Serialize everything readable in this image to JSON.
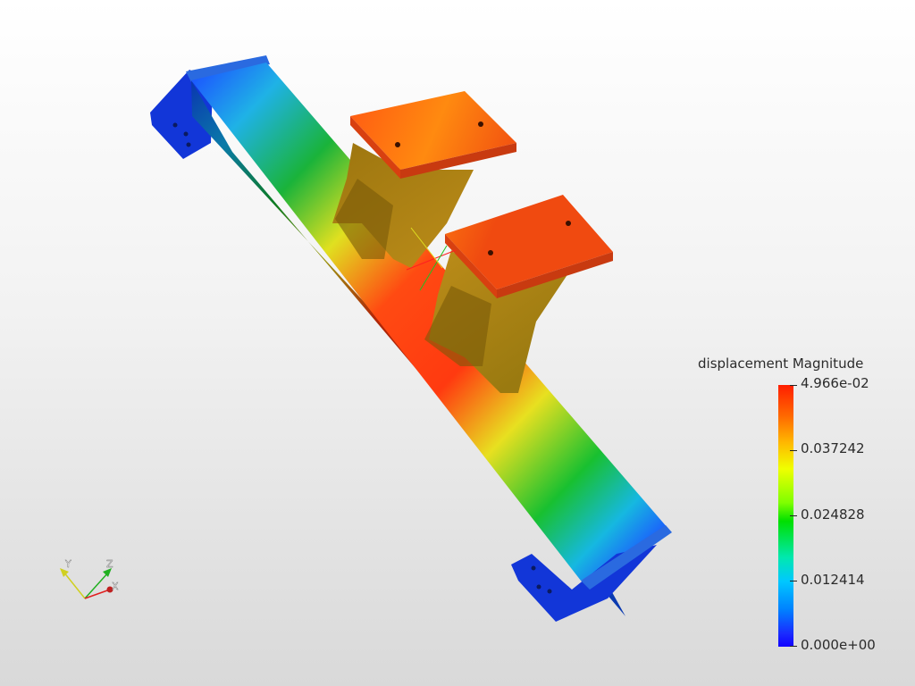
{
  "legend": {
    "title": "displacement Magnitude",
    "max_label": "4.966e-02",
    "labels": [
      "0.037242",
      "0.024828",
      "0.012414"
    ],
    "min_label": "0.000e+00",
    "colormap": [
      "#1000ff",
      "#0080ff",
      "#00c8ff",
      "#00e000",
      "#f0ff00",
      "#ffb800",
      "#ff1e00"
    ]
  },
  "axes": {
    "x_label": "X",
    "y_label": "Y",
    "z_label": "Z"
  }
}
